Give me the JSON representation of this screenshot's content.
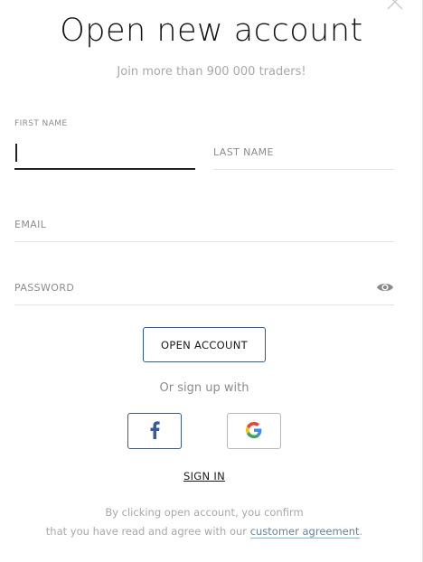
{
  "dialog": {
    "title": "Open new account",
    "subtitle": "Join more than 900 000 traders!"
  },
  "form": {
    "first_name": {
      "label": "FIRST NAME",
      "value": "",
      "focused": true
    },
    "last_name": {
      "label": "LAST NAME",
      "value": ""
    },
    "email": {
      "label": "EMAIL",
      "value": ""
    },
    "password": {
      "label": "PASSWORD",
      "value": "",
      "toggle_icon": "eye-icon"
    },
    "submit_label": "OPEN ACCOUNT"
  },
  "social": {
    "prompt": "Or sign up with",
    "providers": [
      {
        "name": "facebook",
        "icon": "facebook-icon",
        "color": "#3b5998"
      },
      {
        "name": "google",
        "icon": "google-icon"
      }
    ]
  },
  "signin_label": "SIGN IN",
  "terms": {
    "line1": "By clicking open account, you confirm",
    "line2_prefix": "that you have read and agree with our ",
    "link": "customer agreement",
    "line2_suffix": "."
  },
  "colors": {
    "accent_border": "#2a5c98",
    "facebook": "#3b5998",
    "link_underline": "#6ec0d8"
  }
}
